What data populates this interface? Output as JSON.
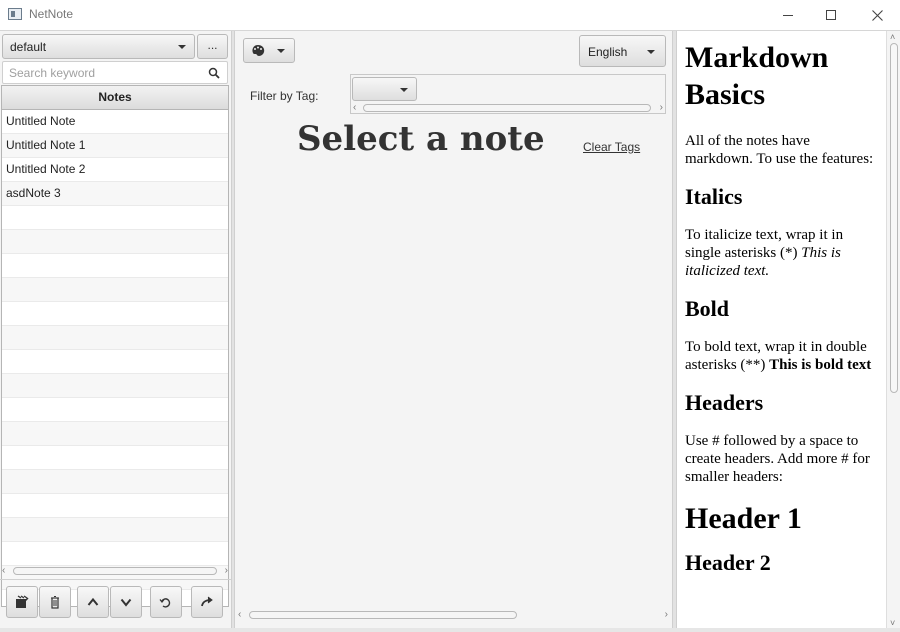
{
  "window": {
    "title": "NetNote"
  },
  "left_panel": {
    "collection": "default",
    "more_label": "...",
    "search_placeholder": "Search keyword",
    "table_header": "Notes",
    "notes": [
      "Untitled Note",
      "Untitled Note 1",
      "Untitled Note 2",
      "asdNote 3"
    ],
    "toolbar_icons": [
      "add-note-icon",
      "delete-icon",
      "arrow-up-icon",
      "arrow-down-icon",
      "refresh-icon",
      "redo-icon"
    ]
  },
  "center_panel": {
    "language": "English",
    "filter_label": "Filter by Tag:",
    "title": "Select a note",
    "clear_tags": "Clear Tags"
  },
  "preview": {
    "h1": "Markdown Basics",
    "intro_line1": "All of the notes have",
    "intro_line2": "markdown. To use the features:",
    "italics_heading": "Italics",
    "italics_line1": "To italicize text, wrap it in",
    "italics_line2_a": "single asterisks (*) ",
    "italics_line2_b": "This is",
    "italics_line3": "italicized text.",
    "bold_heading": "Bold",
    "bold_line1": "To bold text, wrap it in double",
    "bold_line2_a": "asterisks (**) ",
    "bold_line2_b": "This is bold text",
    "headers_heading": "Headers",
    "headers_line1": "Use # followed by a space to",
    "headers_line2": "create headers. Add more # for",
    "headers_line3": "smaller headers:",
    "header1": "Header 1",
    "header2": "Header 2"
  }
}
